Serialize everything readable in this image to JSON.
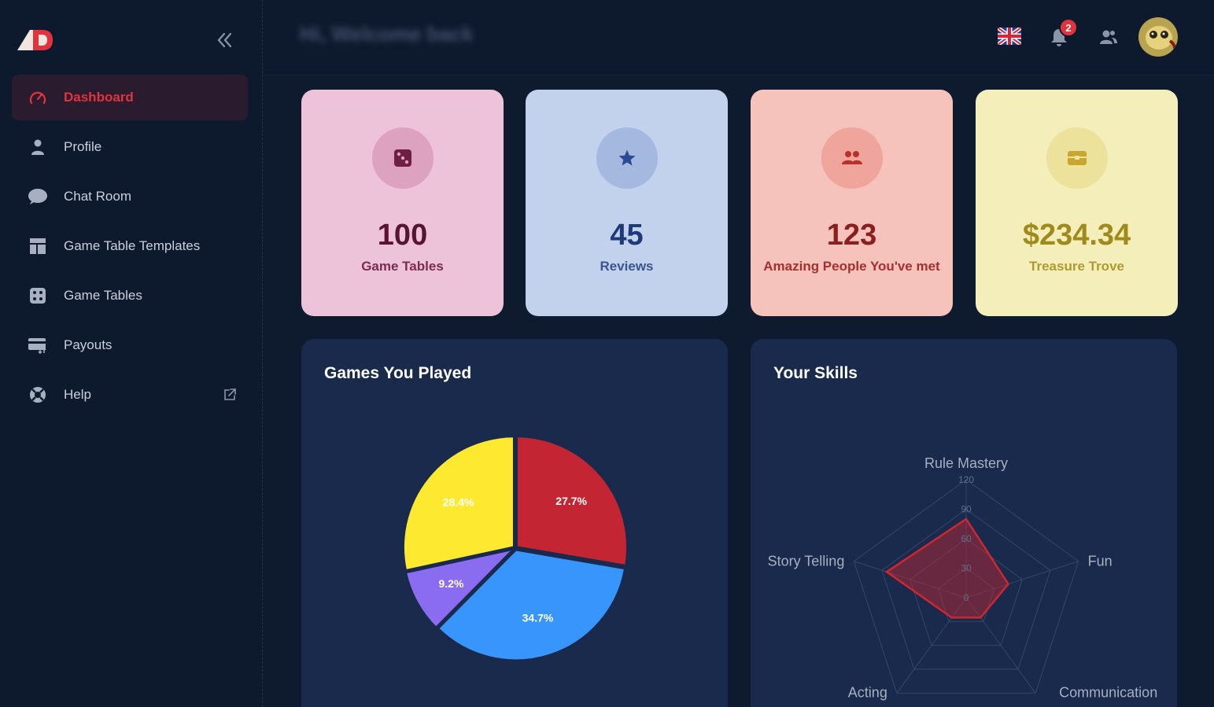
{
  "sidebar": {
    "items": [
      {
        "label": "Dashboard",
        "icon": "gauge-icon",
        "active": true
      },
      {
        "label": "Profile",
        "icon": "person-icon"
      },
      {
        "label": "Chat Room",
        "icon": "chat-bubble-icon"
      },
      {
        "label": "Game Table Templates",
        "icon": "layout-template-icon"
      },
      {
        "label": "Game Tables",
        "icon": "dice-icon"
      },
      {
        "label": "Payouts",
        "icon": "card-transfer-icon"
      },
      {
        "label": "Help",
        "icon": "lifebuoy-icon",
        "external": true
      }
    ]
  },
  "header": {
    "welcome": "Hi, Welcome back",
    "notifications_count": "2"
  },
  "stats": [
    {
      "value": "100",
      "label": "Game Tables",
      "icon": "dice-icon"
    },
    {
      "value": "45",
      "label": "Reviews",
      "icon": "star-icon"
    },
    {
      "value": "123",
      "label": "Amazing People You've met",
      "icon": "group-icon"
    },
    {
      "value": "$234.34",
      "label": "Treasure Trove",
      "icon": "chest-icon"
    }
  ],
  "panels": {
    "games_title": "Games You Played",
    "skills_title": "Your Skills"
  },
  "colors": {
    "accent": "#e0333e",
    "pie_red": "#c32632",
    "pie_blue": "#3795fb",
    "pie_purple": "#8a6cf0",
    "pie_yellow": "#fde92f"
  },
  "chart_data": [
    {
      "type": "pie",
      "title": "Games You Played",
      "slices": [
        {
          "label": "27.7%",
          "value": 27.7,
          "color": "#c32632"
        },
        {
          "label": "34.7%",
          "value": 34.7,
          "color": "#3795fb"
        },
        {
          "label": "9.2%",
          "value": 9.2,
          "color": "#8a6cf0"
        },
        {
          "label": "28.4%",
          "value": 28.4,
          "color": "#fde92f"
        }
      ]
    },
    {
      "type": "radar",
      "title": "Your Skills",
      "axes": [
        "Rule Mastery",
        "Fun",
        "Communication",
        "Acting",
        "Story Telling"
      ],
      "values": [
        80,
        45,
        25,
        25,
        85
      ],
      "rmax": 120,
      "ticks": [
        "0",
        "30",
        "60",
        "90",
        "120"
      ]
    }
  ]
}
